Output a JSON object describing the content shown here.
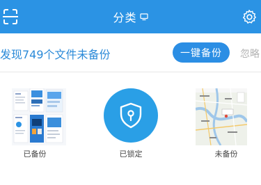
{
  "header": {
    "title": "分类",
    "scan_icon": "scan-frame-icon",
    "monitor_icon": "monitor-icon",
    "settings_icon": "gear-icon",
    "bar_color": "#2b93e4"
  },
  "notice": {
    "text": "发现749个文件未备份",
    "backup_label": "一键备份",
    "ignore_label": "忽略",
    "accent_color": "#2b8ee4"
  },
  "categories": [
    {
      "label": "已备份",
      "thumb": "screenshot-collage-thumbnail"
    },
    {
      "label": "已锁定",
      "icon": "shield-lock-icon"
    },
    {
      "label": "未备份",
      "thumb": "map-screenshot-thumbnail"
    }
  ]
}
